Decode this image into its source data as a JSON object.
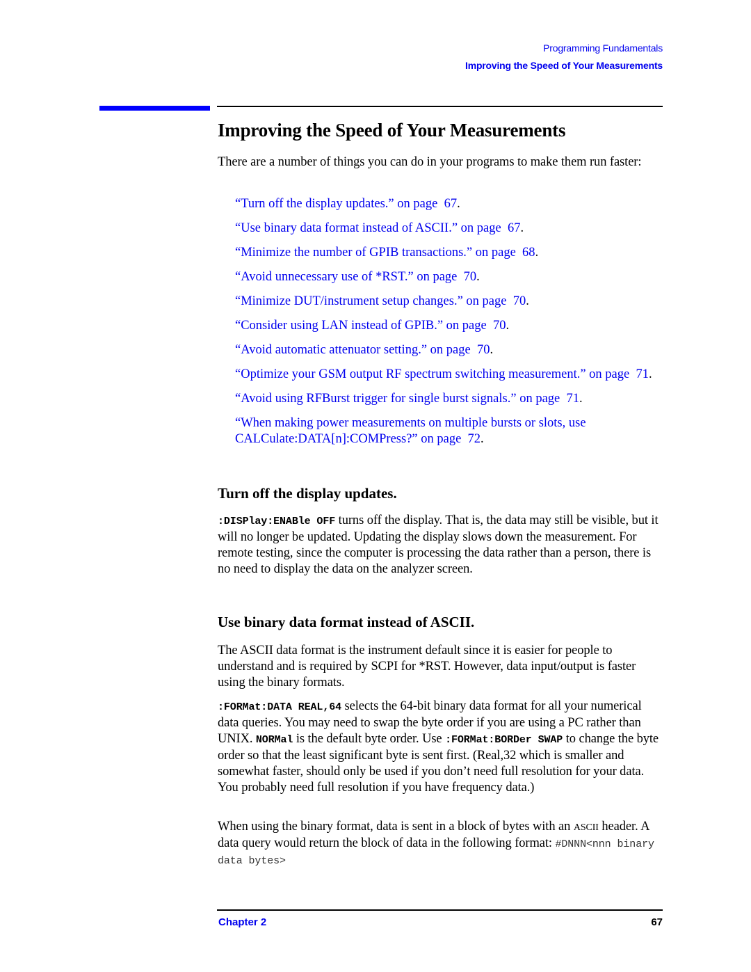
{
  "header": {
    "chapter_title": "Programming Fundamentals",
    "section_title": "Improving the Speed of Your Measurements"
  },
  "page_title": "Improving the Speed of Your Measurements",
  "intro": "There are a number of things you can do in your programs to make them run faster:",
  "toc": [
    {
      "link": "“Turn off the display updates.” on page  67",
      "end": "."
    },
    {
      "link": "“Use binary data format instead of ASCII.” on page  67",
      "end": "."
    },
    {
      "link": "“Minimize the number of GPIB transactions.” on page  68",
      "end": "."
    },
    {
      "link": "“Avoid unnecessary use of *RST.” on page  70",
      "end": "."
    },
    {
      "link": "“Minimize DUT/instrument setup changes.” on page  70",
      "end": "."
    },
    {
      "link": "“Consider using LAN instead of GPIB.” on page  70",
      "end": "."
    },
    {
      "link": "“Avoid automatic attenuator setting.” on page  70",
      "end": "."
    },
    {
      "link": "“Optimize your GSM output RF spectrum switching measurement.” on page  71",
      "end": "."
    },
    {
      "link": "“Avoid using RFBurst trigger for single burst signals.” on page  71",
      "end": "."
    },
    {
      "link": "“When making power measurements on multiple bursts or slots, use CALCulate:DATA[n]:COMPress?” on page  72",
      "end": "."
    }
  ],
  "section_display": {
    "heading": "Turn off the display updates.",
    "code": ":DISPlay:ENABle OFF",
    "text": " turns off the display. That is, the data may still be visible, but it will no longer be updated. Updating the display slows down the measurement. For remote testing, since the computer is processing the data rather than a person, there is no need to display the data on the analyzer screen."
  },
  "section_binary": {
    "heading": "Use binary data format instead of ASCII.",
    "para1": "The ASCII data format is the instrument default since it is easier for people to understand and is required by SCPI for *RST. However, data input/output is faster using the binary formats.",
    "para2": {
      "code1": ":FORMat:DATA REAL,64",
      "text1": " selects the 64-bit binary data format for all your numerical data queries. You may need to swap the byte order if you are using a PC rather than UNIX. ",
      "code2": "NORMal",
      "text2": " is the default byte order. Use ",
      "code3": ":FORMat:BORDer SWAP",
      "text3": " to change the byte order so that the least significant byte is sent first. (Real,32 which is smaller and somewhat faster, should only be used if you don’t need full resolution for your data. You probably need full resolution if you have frequency data.)"
    },
    "para3": {
      "text1": "When using the binary format, data is sent in a block of bytes with an ",
      "ascii": "ASCII",
      "text2": " header. A data query would return the block of data in the following format: ",
      "format": "#DNNN<nnn binary data bytes>"
    }
  },
  "footer": {
    "chapter": "Chapter 2",
    "page_number": "67"
  }
}
